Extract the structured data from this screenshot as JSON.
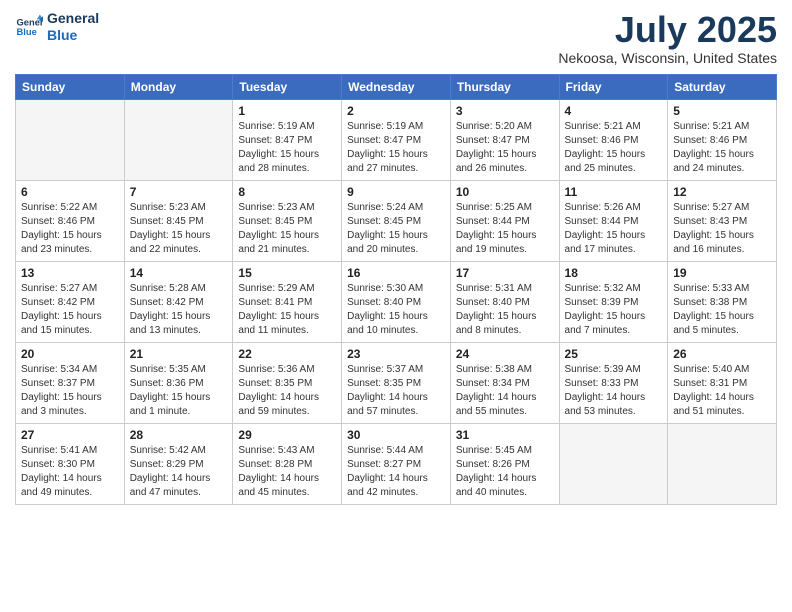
{
  "logo": {
    "line1": "General",
    "line2": "Blue"
  },
  "title": "July 2025",
  "location": "Nekoosa, Wisconsin, United States",
  "weekdays": [
    "Sunday",
    "Monday",
    "Tuesday",
    "Wednesday",
    "Thursday",
    "Friday",
    "Saturday"
  ],
  "weeks": [
    [
      {
        "day": "",
        "info": ""
      },
      {
        "day": "",
        "info": ""
      },
      {
        "day": "1",
        "info": "Sunrise: 5:19 AM\nSunset: 8:47 PM\nDaylight: 15 hours\nand 28 minutes."
      },
      {
        "day": "2",
        "info": "Sunrise: 5:19 AM\nSunset: 8:47 PM\nDaylight: 15 hours\nand 27 minutes."
      },
      {
        "day": "3",
        "info": "Sunrise: 5:20 AM\nSunset: 8:47 PM\nDaylight: 15 hours\nand 26 minutes."
      },
      {
        "day": "4",
        "info": "Sunrise: 5:21 AM\nSunset: 8:46 PM\nDaylight: 15 hours\nand 25 minutes."
      },
      {
        "day": "5",
        "info": "Sunrise: 5:21 AM\nSunset: 8:46 PM\nDaylight: 15 hours\nand 24 minutes."
      }
    ],
    [
      {
        "day": "6",
        "info": "Sunrise: 5:22 AM\nSunset: 8:46 PM\nDaylight: 15 hours\nand 23 minutes."
      },
      {
        "day": "7",
        "info": "Sunrise: 5:23 AM\nSunset: 8:45 PM\nDaylight: 15 hours\nand 22 minutes."
      },
      {
        "day": "8",
        "info": "Sunrise: 5:23 AM\nSunset: 8:45 PM\nDaylight: 15 hours\nand 21 minutes."
      },
      {
        "day": "9",
        "info": "Sunrise: 5:24 AM\nSunset: 8:45 PM\nDaylight: 15 hours\nand 20 minutes."
      },
      {
        "day": "10",
        "info": "Sunrise: 5:25 AM\nSunset: 8:44 PM\nDaylight: 15 hours\nand 19 minutes."
      },
      {
        "day": "11",
        "info": "Sunrise: 5:26 AM\nSunset: 8:44 PM\nDaylight: 15 hours\nand 17 minutes."
      },
      {
        "day": "12",
        "info": "Sunrise: 5:27 AM\nSunset: 8:43 PM\nDaylight: 15 hours\nand 16 minutes."
      }
    ],
    [
      {
        "day": "13",
        "info": "Sunrise: 5:27 AM\nSunset: 8:42 PM\nDaylight: 15 hours\nand 15 minutes."
      },
      {
        "day": "14",
        "info": "Sunrise: 5:28 AM\nSunset: 8:42 PM\nDaylight: 15 hours\nand 13 minutes."
      },
      {
        "day": "15",
        "info": "Sunrise: 5:29 AM\nSunset: 8:41 PM\nDaylight: 15 hours\nand 11 minutes."
      },
      {
        "day": "16",
        "info": "Sunrise: 5:30 AM\nSunset: 8:40 PM\nDaylight: 15 hours\nand 10 minutes."
      },
      {
        "day": "17",
        "info": "Sunrise: 5:31 AM\nSunset: 8:40 PM\nDaylight: 15 hours\nand 8 minutes."
      },
      {
        "day": "18",
        "info": "Sunrise: 5:32 AM\nSunset: 8:39 PM\nDaylight: 15 hours\nand 7 minutes."
      },
      {
        "day": "19",
        "info": "Sunrise: 5:33 AM\nSunset: 8:38 PM\nDaylight: 15 hours\nand 5 minutes."
      }
    ],
    [
      {
        "day": "20",
        "info": "Sunrise: 5:34 AM\nSunset: 8:37 PM\nDaylight: 15 hours\nand 3 minutes."
      },
      {
        "day": "21",
        "info": "Sunrise: 5:35 AM\nSunset: 8:36 PM\nDaylight: 15 hours\nand 1 minute."
      },
      {
        "day": "22",
        "info": "Sunrise: 5:36 AM\nSunset: 8:35 PM\nDaylight: 14 hours\nand 59 minutes."
      },
      {
        "day": "23",
        "info": "Sunrise: 5:37 AM\nSunset: 8:35 PM\nDaylight: 14 hours\nand 57 minutes."
      },
      {
        "day": "24",
        "info": "Sunrise: 5:38 AM\nSunset: 8:34 PM\nDaylight: 14 hours\nand 55 minutes."
      },
      {
        "day": "25",
        "info": "Sunrise: 5:39 AM\nSunset: 8:33 PM\nDaylight: 14 hours\nand 53 minutes."
      },
      {
        "day": "26",
        "info": "Sunrise: 5:40 AM\nSunset: 8:31 PM\nDaylight: 14 hours\nand 51 minutes."
      }
    ],
    [
      {
        "day": "27",
        "info": "Sunrise: 5:41 AM\nSunset: 8:30 PM\nDaylight: 14 hours\nand 49 minutes."
      },
      {
        "day": "28",
        "info": "Sunrise: 5:42 AM\nSunset: 8:29 PM\nDaylight: 14 hours\nand 47 minutes."
      },
      {
        "day": "29",
        "info": "Sunrise: 5:43 AM\nSunset: 8:28 PM\nDaylight: 14 hours\nand 45 minutes."
      },
      {
        "day": "30",
        "info": "Sunrise: 5:44 AM\nSunset: 8:27 PM\nDaylight: 14 hours\nand 42 minutes."
      },
      {
        "day": "31",
        "info": "Sunrise: 5:45 AM\nSunset: 8:26 PM\nDaylight: 14 hours\nand 40 minutes."
      },
      {
        "day": "",
        "info": ""
      },
      {
        "day": "",
        "info": ""
      }
    ]
  ]
}
